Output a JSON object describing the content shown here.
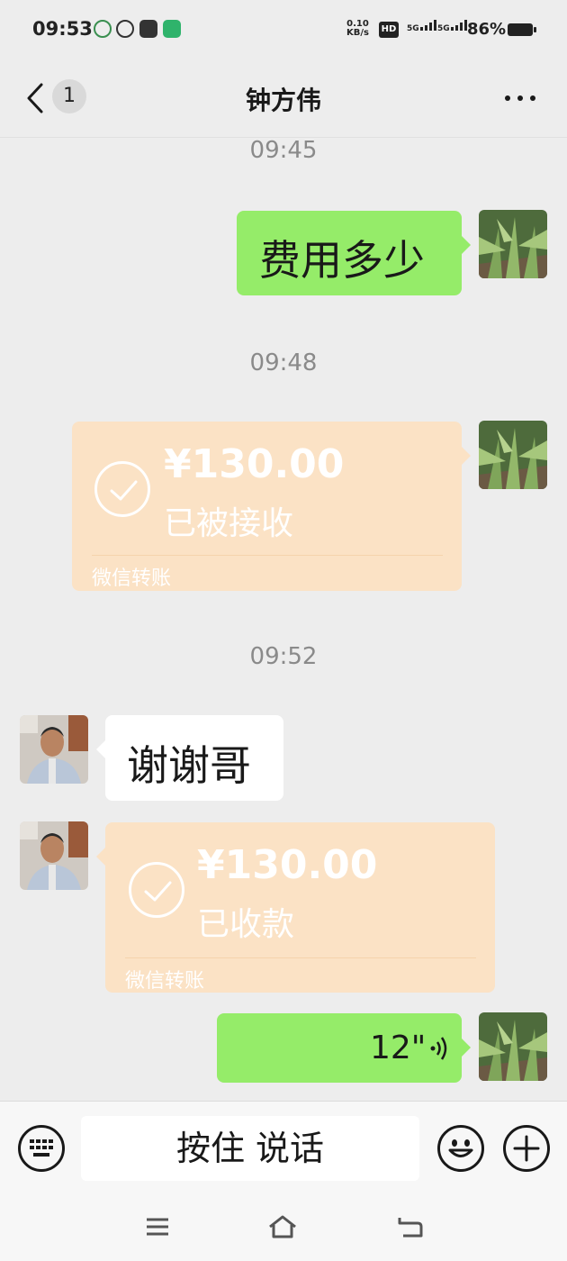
{
  "status_bar": {
    "time": "09:53",
    "net_speed_top": "0.10",
    "net_speed_bottom": "KB/s",
    "hd_label": "HD",
    "sim1_label": "5G",
    "sim2_label": "5G",
    "battery_text": "86%",
    "battery_level": 0.86,
    "app_icons": [
      "app-notification-icon",
      "camera-app-icon",
      "shopping-bag-icon",
      "home-app-icon"
    ]
  },
  "header": {
    "back_icon": "chevron-left-icon",
    "unread_count": "1",
    "title": "钟方伟",
    "more_icon": "more-dots-icon"
  },
  "messages": {
    "ts1": "09:45",
    "msg1_text": "费用多少",
    "ts2": "09:48",
    "transfer1": {
      "amount": "¥130.00",
      "status": "已被接收",
      "label": "微信转账"
    },
    "ts3": "09:52",
    "msg2_text": "谢谢哥",
    "transfer2": {
      "amount": "¥130.00",
      "status": "已收款",
      "label": "微信转账"
    },
    "voice_duration": "12\""
  },
  "input_bar": {
    "keyboard_icon": "keyboard-icon",
    "hold_to_talk": "按住 说话",
    "emoji_icon": "emoji-icon",
    "plus_icon": "plus-icon"
  },
  "colors": {
    "sent_bubble": "#95ec69",
    "transfer_bubble": "#fbe2c5",
    "background": "#ededed"
  }
}
